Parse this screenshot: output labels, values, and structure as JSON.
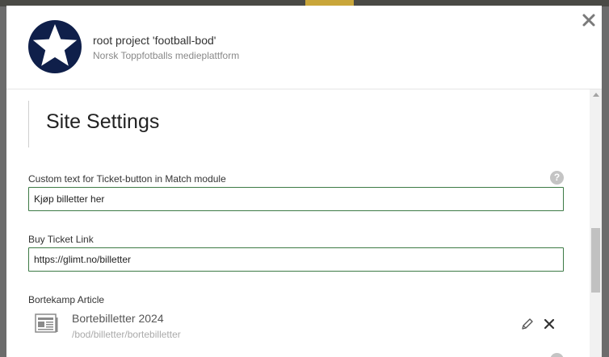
{
  "header": {
    "project_title": "root project 'football-bod'",
    "project_subtitle": "Norsk Toppfotballs medieplattform"
  },
  "section": {
    "heading": "Site Settings"
  },
  "fields": {
    "ticket_text": {
      "label": "Custom text for Ticket-button in Match module",
      "value": "Kjøp billetter her"
    },
    "ticket_link": {
      "label": "Buy Ticket Link",
      "value": "https://glimt.no/billetter"
    },
    "away_article": {
      "label": "Bortekamp Article",
      "title": "Bortebilletter 2024",
      "path": "/bod/billetter/bortebilletter"
    }
  },
  "help_icon_text": "?",
  "colors": {
    "logo_navy": "#0f1f4a",
    "input_border": "#3c7a45",
    "help_icon": "#c4c4c4"
  },
  "icons": {
    "close": "close-icon",
    "logo": "star-logo",
    "help": "help-icon",
    "article": "article-icon",
    "edit": "pencil-icon",
    "remove": "x-icon"
  }
}
